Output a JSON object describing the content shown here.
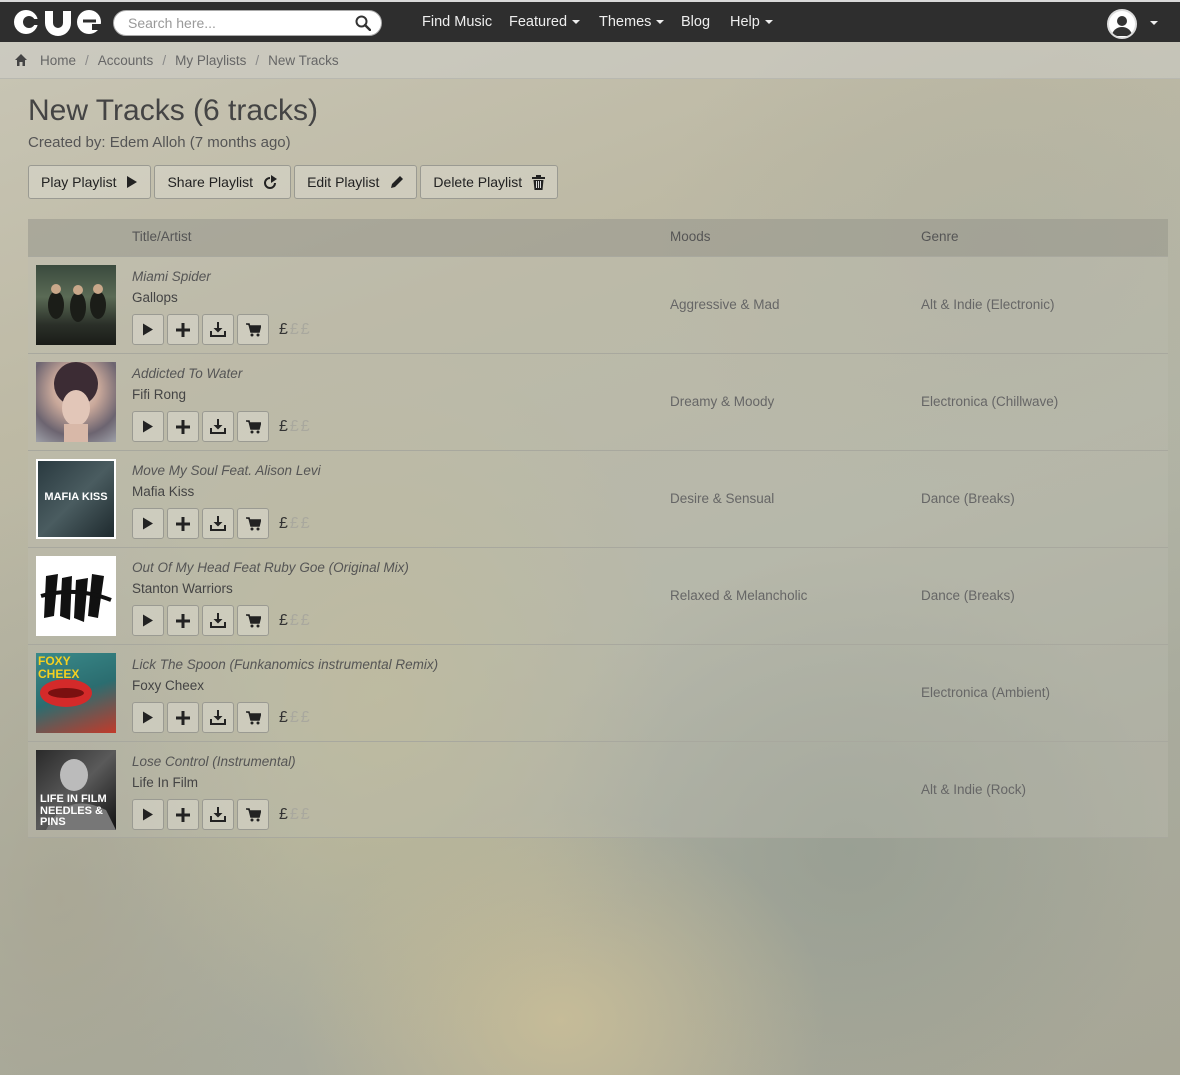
{
  "header": {
    "logo_text": "cue",
    "search_placeholder": "Search here...",
    "nav": [
      {
        "label": "Find Music",
        "dropdown": false
      },
      {
        "label": "Featured",
        "dropdown": true
      },
      {
        "label": "Themes",
        "dropdown": true
      },
      {
        "label": "Blog",
        "dropdown": false
      },
      {
        "label": "Help",
        "dropdown": true
      }
    ]
  },
  "breadcrumb": [
    "Home",
    "Accounts",
    "My Playlists",
    "New Tracks"
  ],
  "page": {
    "title": "New Tracks (6 tracks)",
    "subtitle": "Created by: Edem Alloh (7 months ago)",
    "buttons": {
      "play": "Play Playlist",
      "share": "Share Playlist",
      "edit": "Edit Playlist",
      "delete": "Delete Playlist"
    }
  },
  "table": {
    "headers": {
      "title": "Title/Artist",
      "moods": "Moods",
      "genre": "Genre"
    },
    "rows": [
      {
        "title": "Miami Spider",
        "artist": "Gallops",
        "mood": "Aggressive & Mad",
        "genre": "Alt & Indie (Electronic)",
        "price_full": "£",
        "price_dim": "££",
        "art_text": ""
      },
      {
        "title": "Addicted To Water",
        "artist": "Fifi Rong",
        "mood": "Dreamy & Moody",
        "genre": "Electronica (Chillwave)",
        "price_full": "£",
        "price_dim": "££",
        "art_text": ""
      },
      {
        "title": "Move My Soul Feat. Alison Levi",
        "artist": "Mafia Kiss",
        "mood": "Desire & Sensual",
        "genre": "Dance (Breaks)",
        "price_full": "£",
        "price_dim": "££",
        "art_text": "MAFIA KISS"
      },
      {
        "title": "Out Of My Head Feat Ruby Goe (Original Mix)",
        "artist": "Stanton Warriors",
        "mood": "Relaxed & Melancholic",
        "genre": "Dance (Breaks)",
        "price_full": "£",
        "price_dim": "££",
        "art_text": ""
      },
      {
        "title": "Lick The Spoon (Funkanomics instrumental Remix)",
        "artist": "Foxy Cheex",
        "mood": "",
        "genre": "Electronica (Ambient)",
        "price_full": "£",
        "price_dim": "££",
        "art_text": "FOXY CHEEX"
      },
      {
        "title": "Lose Control (Instrumental)",
        "artist": "Life In Film",
        "mood": "",
        "genre": "Alt & Indie (Rock)",
        "price_full": "£",
        "price_dim": "££",
        "art_text": "LIFE IN FILM NEEDLES & PINS"
      }
    ]
  },
  "colors": {
    "navbar": "#2e2e2e",
    "accent": "#ffffff"
  }
}
